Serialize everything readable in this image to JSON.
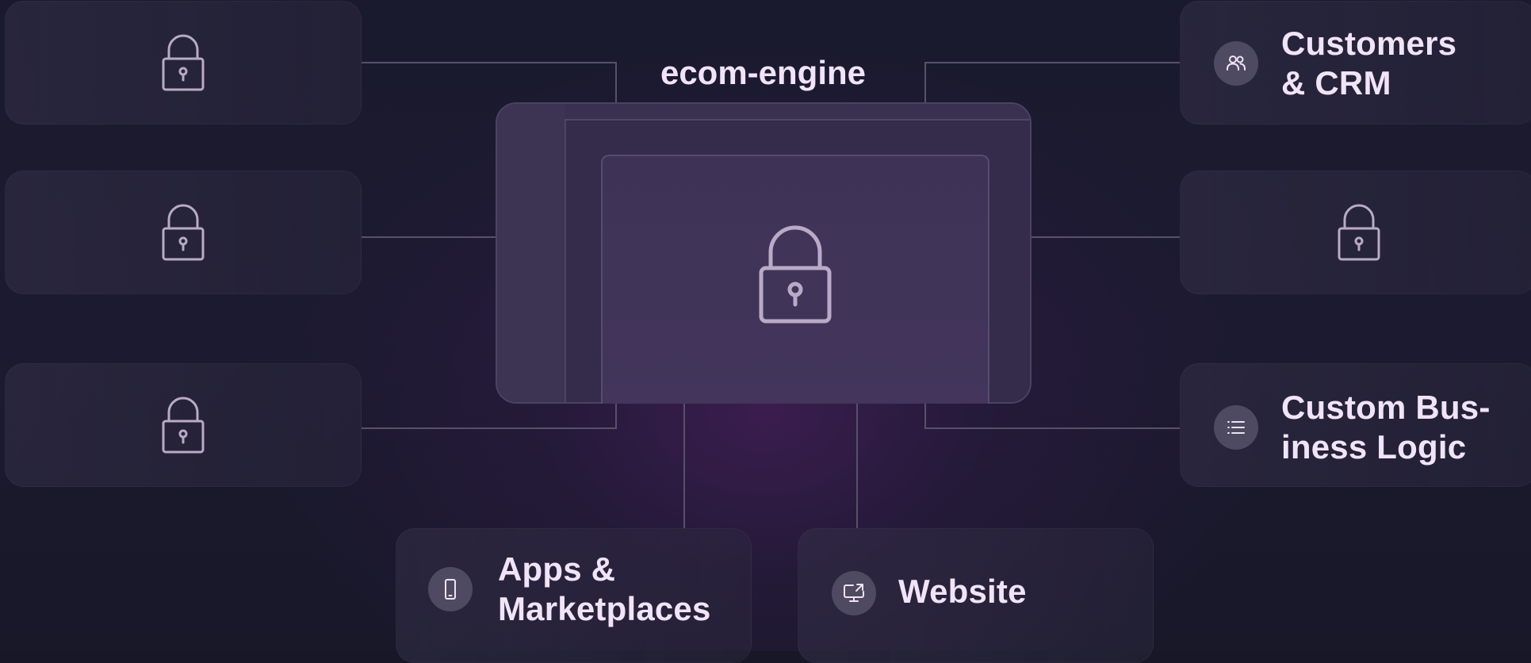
{
  "engine": {
    "title": "ecom-engine",
    "icon": "lock-icon"
  },
  "left_cards": [
    {
      "icon": "lock-icon",
      "locked": true
    },
    {
      "icon": "lock-icon",
      "locked": true
    },
    {
      "icon": "lock-icon",
      "locked": true
    }
  ],
  "right_cards": [
    {
      "icon": "users-icon",
      "label_lines": [
        "Customers",
        "& CRM"
      ]
    },
    {
      "icon": "lock-icon",
      "locked": true
    },
    {
      "icon": "list-icon",
      "label_lines": [
        "Custom Bus-",
        "iness Logic"
      ]
    }
  ],
  "bottom_cards": [
    {
      "icon": "smartphone-icon",
      "label_lines": [
        "Apps &",
        "Marketplaces"
      ]
    },
    {
      "icon": "monitor-share-icon",
      "label_lines": [
        "Website"
      ]
    }
  ],
  "colors": {
    "background": "#1a1a2e",
    "card": "#2f2b42",
    "connector": "#575169",
    "text": "#f1e4f8",
    "lock_stroke": "#b9aac6",
    "badge": "#4e4a62"
  }
}
